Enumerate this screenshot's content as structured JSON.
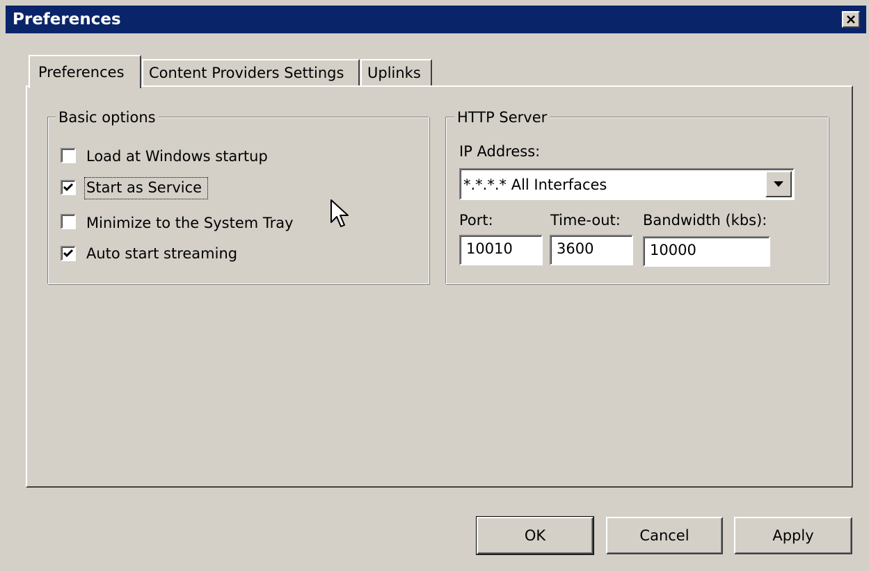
{
  "window": {
    "title": "Preferences",
    "close_label": "✕",
    "titlebar_color": "#0a246a"
  },
  "tabs": [
    {
      "label": "Preferences",
      "active": true
    },
    {
      "label": "Content Providers Settings",
      "active": false
    },
    {
      "label": "Uplinks",
      "active": false
    }
  ],
  "basic_options": {
    "legend": "Basic options",
    "items": [
      {
        "label": "Load at Windows startup",
        "checked": false
      },
      {
        "label": "Start as Service",
        "checked": true
      },
      {
        "label": "Minimize to the System Tray",
        "checked": false
      },
      {
        "label": "Auto start streaming",
        "checked": true
      }
    ]
  },
  "http_server": {
    "legend": "HTTP Server",
    "ip_label": "IP Address:",
    "ip_value": "*.*.*.* All Interfaces",
    "port_label": "Port:",
    "port_value": "10010",
    "timeout_label": "Time-out:",
    "timeout_value": "3600",
    "bandwidth_label": "Bandwidth (kbs):",
    "bandwidth_value": "10000"
  },
  "buttons": {
    "ok": "OK",
    "cancel": "Cancel",
    "apply": "Apply"
  },
  "icons": {
    "close": "close-icon",
    "checkmark": "checkmark-icon",
    "dropdown": "chevron-down-icon",
    "cursor": "mouse-cursor-icon"
  }
}
